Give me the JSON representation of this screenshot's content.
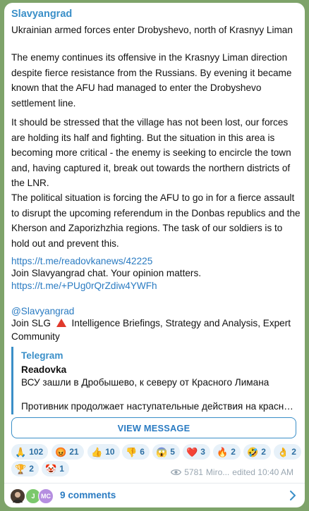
{
  "post": {
    "channel_name": "Slavyangrad",
    "headline": "Ukrainian armed forces enter Drobyshevo, north of Krasnyy Liman",
    "paragraphs": [
      "The enemy continues its offensive in the Krasnyy Liman direction despite fierce resistance from the Russians. By evening it became known that the AFU had managed to enter the Drobyshevo settlement line.",
      "It should be stressed that the village has not been lost, our forces are holding its half and fighting. But the situation in this area is becoming more critical - the enemy is seeking to encircle the town and, having captured it, break out towards the northern districts of the LNR.",
      "The political situation is forcing the AFU to go in for a fierce assault to disrupt the upcoming referendum in the Donbas republics and the Kherson and Zaporizhzhia regions. The task of our soldiers is to hold out and prevent this."
    ],
    "source_link": "https://t.me/readovkanews/42225",
    "join_chat_text": "Join Slavyangrad chat. Your opinion matters.",
    "chat_link": "https://t.me/+PUg0rQrZdiw4YWFh",
    "channel_handle": "@Slavyangrad",
    "join_slg_prefix": "Join SLG",
    "join_slg_rest": "Intelligence Briefings, Strategy and Analysis, Expert Community"
  },
  "forward_preview": {
    "source": "Telegram",
    "author": "Readovka",
    "title": "ВСУ зашли в Дробышево, к северу от Красного Лимана",
    "body": "Противник продолжает наступательные действия на краснол..."
  },
  "view_message_label": "VIEW MESSAGE",
  "reactions": [
    {
      "emoji": "🙏",
      "count": "102"
    },
    {
      "emoji": "😡",
      "count": "21"
    },
    {
      "emoji": "👍",
      "count": "10"
    },
    {
      "emoji": "👎",
      "count": "6"
    },
    {
      "emoji": "😱",
      "count": "5"
    },
    {
      "emoji": "❤️",
      "count": "3"
    },
    {
      "emoji": "🔥",
      "count": "2"
    },
    {
      "emoji": "🤣",
      "count": "2"
    },
    {
      "emoji": "👌",
      "count": "2"
    },
    {
      "emoji": "🏆",
      "count": "2"
    },
    {
      "emoji": "🤡",
      "count": "1"
    }
  ],
  "meta": {
    "views": "5781",
    "author": "Miro...",
    "edited_time": "edited 10:40 AM"
  },
  "comments": {
    "label": "9 comments",
    "avatars": [
      {
        "initials": "",
        "color": "#6d5a4a"
      },
      {
        "initials": "J",
        "color": "#7bc86c"
      },
      {
        "initials": "MC",
        "color": "#b58ee0"
      }
    ]
  },
  "colors": {
    "accent": "#3a8fc8",
    "link": "#2a7bc2",
    "background": "#7ea36a",
    "reaction_bg": "#e7f1f9"
  }
}
